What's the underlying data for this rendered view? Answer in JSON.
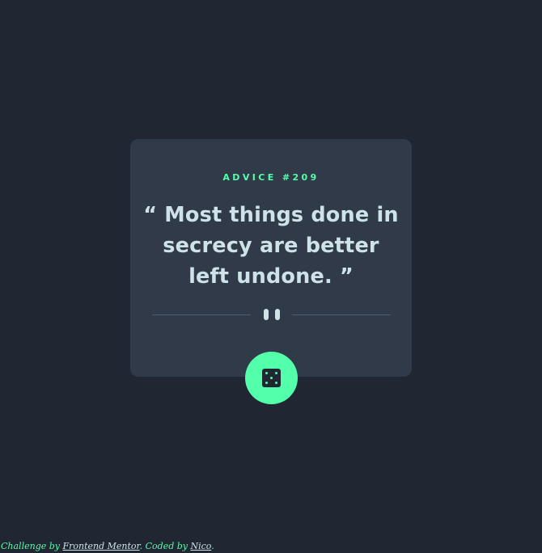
{
  "card": {
    "advice_label": "ADVICE #209",
    "quote": "“ Most things done in secrecy are better left undone. ”"
  },
  "divider": {
    "icon": "pause-icon"
  },
  "dice_button": {
    "icon": "dice-icon"
  },
  "footer": {
    "prefix": "Challenge by",
    "link1": "Frontend Mentor",
    "middle": ". Coded by",
    "link2": "Nico",
    "suffix": "."
  },
  "colors": {
    "background": "#202632",
    "card": "#313a49",
    "accent": "#53ffaa",
    "text": "#cee3e9",
    "divider": "#4f5d74"
  }
}
